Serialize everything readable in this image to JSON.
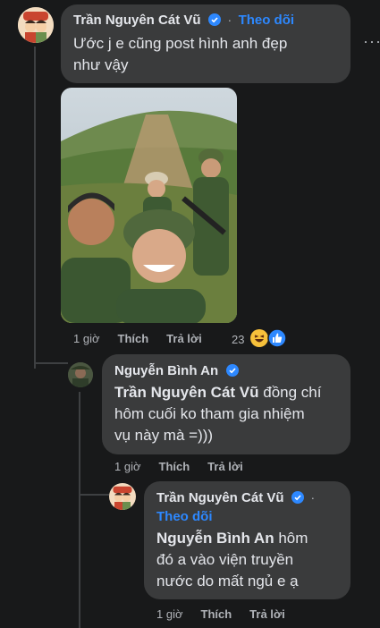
{
  "comment1": {
    "author": "Trần Nguyên Cát Vũ",
    "separator": "·",
    "follow": "Theo dõi",
    "text_line1": "Ước j e cũng post hình anh đẹp",
    "text_line2": "như vậy",
    "time": "1 giờ",
    "like": "Thích",
    "reply": "Trả lời",
    "reaction_count": "23",
    "more": "···"
  },
  "reply1": {
    "author": "Nguyễn Bình An",
    "mention": "Trần Nguyên Cát Vũ",
    "text_rest": " đồng chí",
    "text_line2": "hôm cuối ko tham gia nhiệm",
    "text_line3": "vụ này mà =)))",
    "time": "1 giờ",
    "like": "Thích",
    "reply": "Trả lời"
  },
  "reply2": {
    "author": "Trần Nguyên Cát Vũ",
    "follow": "Theo dõi",
    "mention": "Nguyễn Bình An",
    "text_rest": " hôm",
    "text_line2": "đó a vào viện truyền",
    "text_line3": "nước do mất ngủ e ạ",
    "time": "1 giờ",
    "like": "Thích",
    "reply": "Trả lời"
  },
  "colors": {
    "background": "#18191a",
    "bubble": "#3a3b3c",
    "link": "#2d88ff",
    "meta": "#b0b3b8"
  },
  "icons": [
    "verified-badge-icon",
    "haha-reaction-icon",
    "like-reaction-icon",
    "more-options-icon"
  ]
}
